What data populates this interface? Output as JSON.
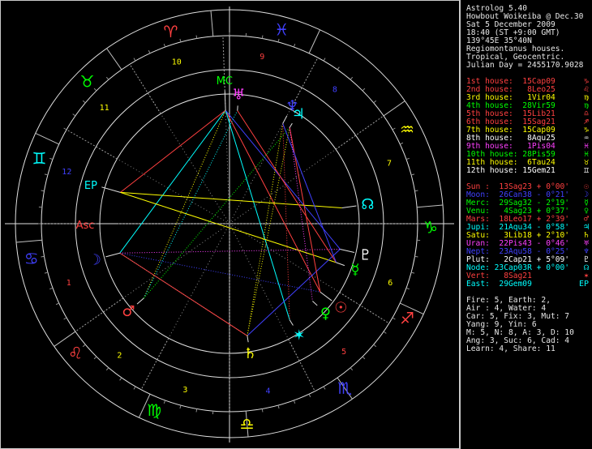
{
  "header": [
    "Astrolog 5.40",
    "Howbout Woikeiba @ Dec.30",
    "Sat 5 December 2009",
    "18:40 (ST +9:00 GMT)",
    "139°45E 35°40N",
    "Regiomontanus houses.",
    "Tropical, Geocentric.",
    "Julian Day = 2455170.9028"
  ],
  "houses": [
    {
      "label": "1st house:",
      "value": "15Cap09",
      "color": "#ff4040",
      "glyph": "♑"
    },
    {
      "label": "2nd house:",
      "value": "8Leo25",
      "color": "#ff4040",
      "glyph": "♌"
    },
    {
      "label": "3rd house:",
      "value": "1Vir04",
      "color": "#ffff00",
      "glyph": "♍"
    },
    {
      "label": "4th house:",
      "value": "28Vir59",
      "color": "#00ff00",
      "glyph": "♍"
    },
    {
      "label": "5th house:",
      "value": "15Lib21",
      "color": "#ff4040",
      "glyph": "♎"
    },
    {
      "label": "6th house:",
      "value": "15Sag21",
      "color": "#ff4040",
      "glyph": "♐"
    },
    {
      "label": "7th house:",
      "value": "15Cap09",
      "color": "#ffff00",
      "glyph": "♑"
    },
    {
      "label": "8th house:",
      "value": "8Aqu25",
      "color": "#ffffff",
      "glyph": "♒"
    },
    {
      "label": "9th house:",
      "value": "1Pis04",
      "color": "#ff40ff",
      "glyph": "♓"
    },
    {
      "label": "10th house:",
      "value": "28Pis59",
      "color": "#00ff00",
      "glyph": "♓"
    },
    {
      "label": "11th house:",
      "value": "6Tau24",
      "color": "#ffff00",
      "glyph": "♉"
    },
    {
      "label": "12th house:",
      "value": "15Gem21",
      "color": "#ffffff",
      "glyph": "♊"
    }
  ],
  "planets": [
    {
      "name": "Sun :",
      "pos": "13Sag23",
      "lat": "+ 0°00'",
      "color": "#ff4040",
      "glyph": "☉"
    },
    {
      "name": "Moon:",
      "pos": "26Can38",
      "lat": "- 0°21'",
      "color": "#4040ff",
      "glyph": "☽"
    },
    {
      "name": "Merc:",
      "pos": "29Sag32",
      "lat": "- 2°19'",
      "color": "#00ff00",
      "glyph": "☿"
    },
    {
      "name": "Venu:",
      "pos": "4Sag23",
      "lat": "+ 0°37'",
      "color": "#00ff00",
      "glyph": "♀"
    },
    {
      "name": "Mars:",
      "pos": "18Leo17",
      "lat": "+ 2°39'",
      "color": "#ff4040",
      "glyph": "♂"
    },
    {
      "name": "Jupi:",
      "pos": "21Aqu34",
      "lat": "- 0°58'",
      "color": "#00ffff",
      "glyph": "♃"
    },
    {
      "name": "Satu:",
      "pos": "3Lib18",
      "lat": "+ 2°10'",
      "color": "#ffff00",
      "glyph": "♄"
    },
    {
      "name": "Uran:",
      "pos": "22Pis43",
      "lat": "- 0°46'",
      "color": "#ff40ff",
      "glyph": "♅"
    },
    {
      "name": "Nept:",
      "pos": "23Aqu58",
      "lat": "- 0°25'",
      "color": "#4040ff",
      "glyph": "♆"
    },
    {
      "name": "Plut:",
      "pos": "2Cap21",
      "lat": "+ 5°09'",
      "color": "#ffffff",
      "glyph": "♇"
    },
    {
      "name": "Node:",
      "pos": "23Cap03R",
      "lat": "+ 0°00'",
      "color": "#00ffff",
      "glyph": "☊"
    },
    {
      "name": "Vert:",
      "pos": "8Sag21",
      "lat": "",
      "color": "#ff4040",
      "glyph": "✶"
    },
    {
      "name": "East:",
      "pos": "29Gem09",
      "lat": "",
      "color": "#00ffff",
      "glyph": "EP"
    }
  ],
  "summary": [
    "Fire: 5, Earth: 2,",
    "Air : 4, Water: 4",
    "Car: 5, Fix: 3, Mut: 7",
    "Yang: 9, Yin: 6",
    "M: 5, N: 8, A: 3, D: 10",
    "Ang: 3, Suc: 6, Cad: 4",
    "Learn: 4, Share: 11"
  ],
  "wheel": {
    "signs": [
      {
        "glyph": "♈",
        "angle": 107,
        "color": "#ff4040"
      },
      {
        "glyph": "♉",
        "angle": 135,
        "color": "#00ff00"
      },
      {
        "glyph": "♊",
        "angle": 161,
        "color": "#00ffff"
      },
      {
        "glyph": "♋",
        "angle": 190,
        "color": "#4040ff"
      },
      {
        "glyph": "♌",
        "angle": 220,
        "color": "#ff4040"
      },
      {
        "glyph": "♍",
        "angle": 248,
        "color": "#00ff00"
      },
      {
        "glyph": "♎",
        "angle": 275,
        "color": "#ffff00"
      },
      {
        "glyph": "♏",
        "angle": 305,
        "color": "#4040ff"
      },
      {
        "glyph": "♐",
        "angle": 332,
        "color": "#ff4040"
      },
      {
        "glyph": "♑",
        "angle": 359,
        "color": "#00ff00"
      },
      {
        "glyph": "♒",
        "angle": 28,
        "color": "#ffff00"
      },
      {
        "glyph": "♓",
        "angle": 75,
        "color": "#4040ff"
      }
    ],
    "house_numbers": [
      {
        "n": "1",
        "angle": 200,
        "color": "#ff4040"
      },
      {
        "n": "2",
        "angle": 230,
        "color": "#ffff00"
      },
      {
        "n": "3",
        "angle": 255,
        "color": "#ffff00"
      },
      {
        "n": "4",
        "angle": 283,
        "color": "#4040ff"
      },
      {
        "n": "5",
        "angle": 312,
        "color": "#ff4040"
      },
      {
        "n": "6",
        "angle": 340,
        "color": "#ffff00"
      },
      {
        "n": "7",
        "angle": 21,
        "color": "#ffff00"
      },
      {
        "n": "8",
        "angle": 52,
        "color": "#4040ff"
      },
      {
        "n": "9",
        "angle": 79,
        "color": "#ff4040"
      },
      {
        "n": "10",
        "angle": 108,
        "color": "#ffff00"
      },
      {
        "n": "11",
        "angle": 137,
        "color": "#ffff00"
      },
      {
        "n": "12",
        "angle": 162,
        "color": "#4040ff"
      }
    ],
    "points": [
      {
        "key": "mc",
        "label": "MC",
        "angle": 92,
        "color": "#00ff00",
        "r": 178
      },
      {
        "key": "asc",
        "label": "Asc",
        "angle": 180,
        "color": "#ff4040",
        "r": 178
      },
      {
        "key": "ep",
        "label": "EP",
        "angle": 164,
        "color": "#00ffff",
        "r": 178
      },
      {
        "key": "uranus",
        "label": "♅",
        "angle": 86,
        "color": "#ff40ff",
        "r": 160
      },
      {
        "key": "jupiter",
        "label": "♃",
        "angle": 58,
        "color": "#00ffff",
        "r": 160
      },
      {
        "key": "neptune",
        "label": "♆",
        "angle": 62,
        "color": "#4040ff",
        "r": 165
      },
      {
        "key": "node",
        "label": "☊",
        "angle": 8,
        "color": "#00ffff",
        "r": 172
      },
      {
        "key": "pluto",
        "label": "♇",
        "angle": 347,
        "color": "#ffffff",
        "r": 172
      },
      {
        "key": "mercury",
        "label": "☿",
        "angle": 340,
        "color": "#00ff00",
        "r": 165
      },
      {
        "key": "sun",
        "label": "☉",
        "angle": 323,
        "color": "#ff4040",
        "r": 172
      },
      {
        "key": "venus",
        "label": "♀",
        "angle": 317,
        "color": "#00ff00",
        "r": 162
      },
      {
        "key": "vertex",
        "label": "✶",
        "angle": 302,
        "color": "#00ffff",
        "r": 162
      },
      {
        "key": "saturn",
        "label": "♄",
        "angle": 279,
        "color": "#ffff00",
        "r": 162
      },
      {
        "key": "mars",
        "label": "♂",
        "angle": 221,
        "color": "#ff4040",
        "r": 165
      },
      {
        "key": "moon",
        "label": "☽",
        "angle": 195,
        "color": "#4040ff",
        "r": 172
      }
    ],
    "aspects": [
      {
        "a": "mc",
        "b": "moon",
        "color": "#00ffff",
        "dash": false
      },
      {
        "a": "mc",
        "b": "sun",
        "color": "#ff4040",
        "dash": false
      },
      {
        "a": "mc",
        "b": "vertex",
        "color": "#00ffff",
        "dash": false
      },
      {
        "a": "mc",
        "b": "ep",
        "color": "#ff4040",
        "dash": false
      },
      {
        "a": "mc",
        "b": "mars",
        "color": "#ffff00",
        "dash": true
      },
      {
        "a": "mc",
        "b": "pluto",
        "color": "#4040ff",
        "dash": false
      },
      {
        "a": "ep",
        "b": "node",
        "color": "#ffff00",
        "dash": false
      },
      {
        "a": "ep",
        "b": "mercury",
        "color": "#ffff00",
        "dash": false
      },
      {
        "a": "moon",
        "b": "pluto",
        "color": "#ff40ff",
        "dash": true
      },
      {
        "a": "moon",
        "b": "sun",
        "color": "#4040ff",
        "dash": true
      },
      {
        "a": "moon",
        "b": "saturn",
        "color": "#00ffff",
        "dash": true
      },
      {
        "a": "mars",
        "b": "uranus",
        "color": "#00ffff",
        "dash": true
      },
      {
        "a": "mars",
        "b": "jupiter",
        "color": "#00ff00",
        "dash": true
      },
      {
        "a": "saturn",
        "b": "pluto",
        "color": "#4040ff",
        "dash": false
      },
      {
        "a": "saturn",
        "b": "neptune",
        "color": "#ffff00",
        "dash": true
      },
      {
        "a": "saturn",
        "b": "jupiter",
        "color": "#ffff00",
        "dash": true
      },
      {
        "a": "saturn",
        "b": "moon",
        "color": "#ff4040",
        "dash": false
      },
      {
        "a": "jupiter",
        "b": "sun",
        "color": "#ff4040",
        "dash": false
      },
      {
        "a": "neptune",
        "b": "vertex",
        "color": "#ff4040",
        "dash": true
      },
      {
        "a": "uranus",
        "b": "mercury",
        "color": "#ff4040",
        "dash": false
      },
      {
        "a": "neptune",
        "b": "mercury",
        "color": "#4040ff",
        "dash": false
      },
      {
        "a": "jupiter",
        "b": "venus",
        "color": "#ff40ff",
        "dash": true
      }
    ]
  }
}
